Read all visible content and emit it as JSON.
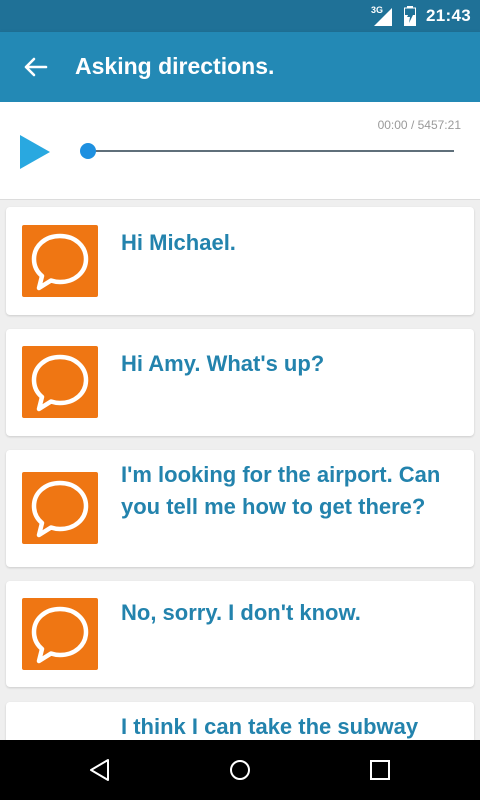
{
  "status_bar": {
    "network": "3G",
    "time": "21:43"
  },
  "app_bar": {
    "title": "Asking directions."
  },
  "player": {
    "time_readout": "00:00 / 5457:21",
    "progress": 0.0
  },
  "messages": [
    {
      "text": "Hi Michael."
    },
    {
      "text": "Hi Amy. What's up?"
    },
    {
      "text": "I'm looking for the airport. Can you tell me how to get there?"
    },
    {
      "text": "No, sorry. I don't know."
    },
    {
      "text": "I think I can take the subway"
    }
  ],
  "icons": {
    "back": "arrow-back-icon",
    "play": "play-icon",
    "bubble": "speech-bubble-icon",
    "nav_back": "nav-back-icon",
    "nav_home": "nav-home-icon",
    "nav_recents": "nav-recents-icon"
  },
  "colors": {
    "status_bar": "#1f7197",
    "app_bar": "#2389b5",
    "accent_text": "#2383ad",
    "bubble_bg": "#ef7613",
    "play": "#29a8e0"
  }
}
